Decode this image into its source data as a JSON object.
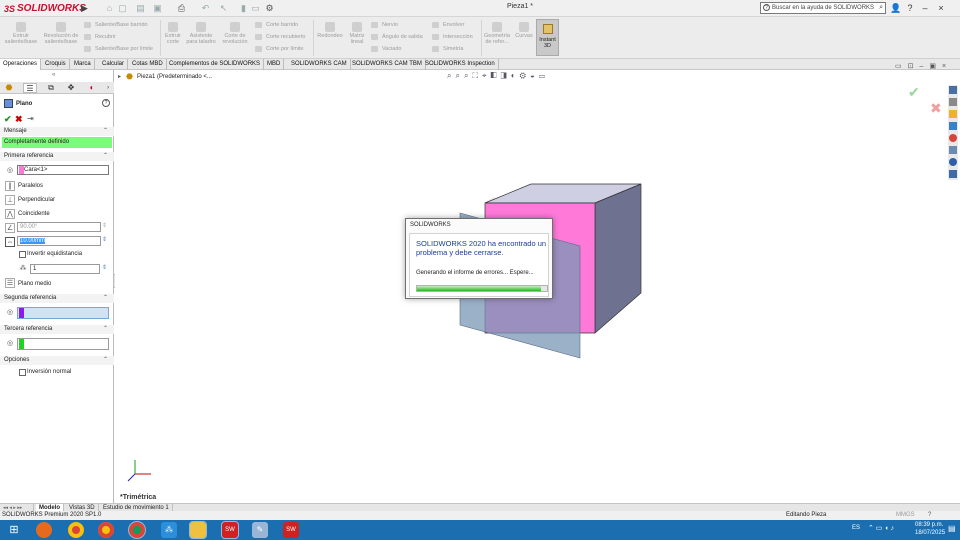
{
  "app": {
    "title": "Pieza1 *",
    "search_placeholder": "Buscar en la ayuda de SOLIDWORKS",
    "logo_text": "SOLIDWORKS"
  },
  "commands": {
    "extrude_boss": "Extruir saliente/base",
    "revolve_boss": "Revolución de saliente/base",
    "swept_boss": "Saliente/Base barrido",
    "lofted_boss": "Recubrir",
    "boundary_boss": "Saliente/Base por límite",
    "extrude_cut": "Extruir corte",
    "hole_wizard": "Asistente para taladro",
    "revolve_cut": "Corte de revolución",
    "swept_cut": "Corte barrido",
    "lofted_cut": "Corte recubierto",
    "boundary_cut": "Corte por límite",
    "fillet": "Redondeo",
    "linear_pattern": "Matriz lineal",
    "rib": "Nervio",
    "draft": "Ángulo de salida",
    "shell": "Vaciado",
    "wrap": "Envolver",
    "intersect": "Intersección",
    "mirror": "Simetría",
    "ref_geometry": "Geometría de refer...",
    "curves": "Curvas",
    "instant3d": "Instant 3D"
  },
  "tabs": [
    "Operaciones",
    "Croquis",
    "Marca",
    "Calcular",
    "Cotas MBD",
    "Complementos de SOLIDWORKS",
    "MBD",
    "SOLIDWORKS CAM",
    "SOLIDWORKS CAM TBM",
    "SOLIDWORKS Inspection"
  ],
  "tree_item": "Pieza1  (Predeterminado <...",
  "panel": {
    "title": "Plano",
    "message_header": "Mensaje",
    "message": "Completamente definido",
    "first_ref_header": "Primera referencia",
    "first_ref_value": "Cara<1>",
    "parallel": "Paralelos",
    "perpendicular": "Perpendicular",
    "coincident": "Coincidente",
    "angle": "90.00°",
    "distance": "10.00mm",
    "flip_offset": "Invertir equidistancia",
    "count": "1",
    "mid_plane": "Plano medio",
    "second_ref_header": "Segunda referencia",
    "third_ref_header": "Tercera referencia",
    "options_header": "Opciones",
    "flip_normal": "Inversión normal"
  },
  "view": {
    "orientation": "*Trimétrica"
  },
  "bottom_tabs": [
    "Modelo",
    "Vistas 3D",
    "Estudio de movimiento 1"
  ],
  "status": {
    "left": "SOLIDWORKS Premium 2020 SP1.0",
    "mode": "Editando Pieza",
    "units": "MMGS"
  },
  "taskbar": {
    "lang": "ES",
    "time": "08:39 p.m.",
    "date": "18/07/2025"
  },
  "dialog": {
    "title": "SOLIDWORKS",
    "message": "SOLIDWORKS 2020 ha encontrado un problema y debe cerrarse.",
    "status": "Generando el informe de errores... Espere...",
    "progress": 0.95
  },
  "colors": {
    "accent_red": "#c8102e",
    "face_pink": "#ff79d9",
    "message_green": "#7bfa7b",
    "taskbar": "#1b6fb0"
  }
}
